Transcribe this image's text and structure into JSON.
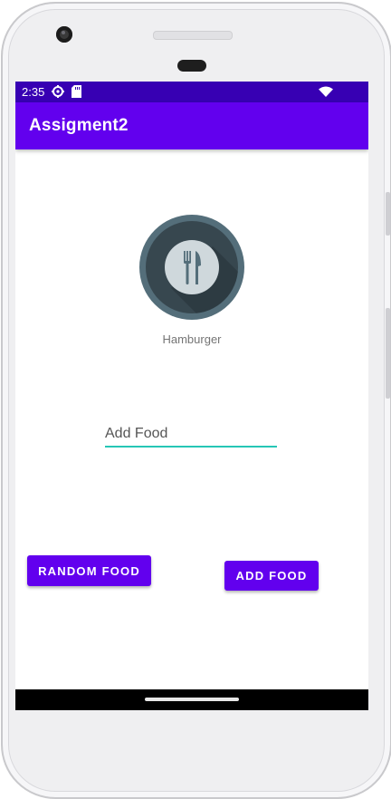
{
  "status_bar": {
    "time": "2:35",
    "icons": [
      "settings-gear-icon",
      "sd-card-icon",
      "wifi-icon"
    ],
    "color": "#3700b3"
  },
  "app_bar": {
    "title": "Assigment2",
    "color": "#6200ee"
  },
  "main": {
    "food_image_icon": "fork-knife-icon",
    "food_name": "Hamburger",
    "food_input": {
      "value": "",
      "placeholder": "Add Food",
      "underline_color": "#26c6b6"
    },
    "random_button_label": "Random Food",
    "add_button_label": "Add Food",
    "button_color": "#6200ee"
  },
  "nav_bar": {
    "icons": [
      "home-pill-icon"
    ]
  }
}
